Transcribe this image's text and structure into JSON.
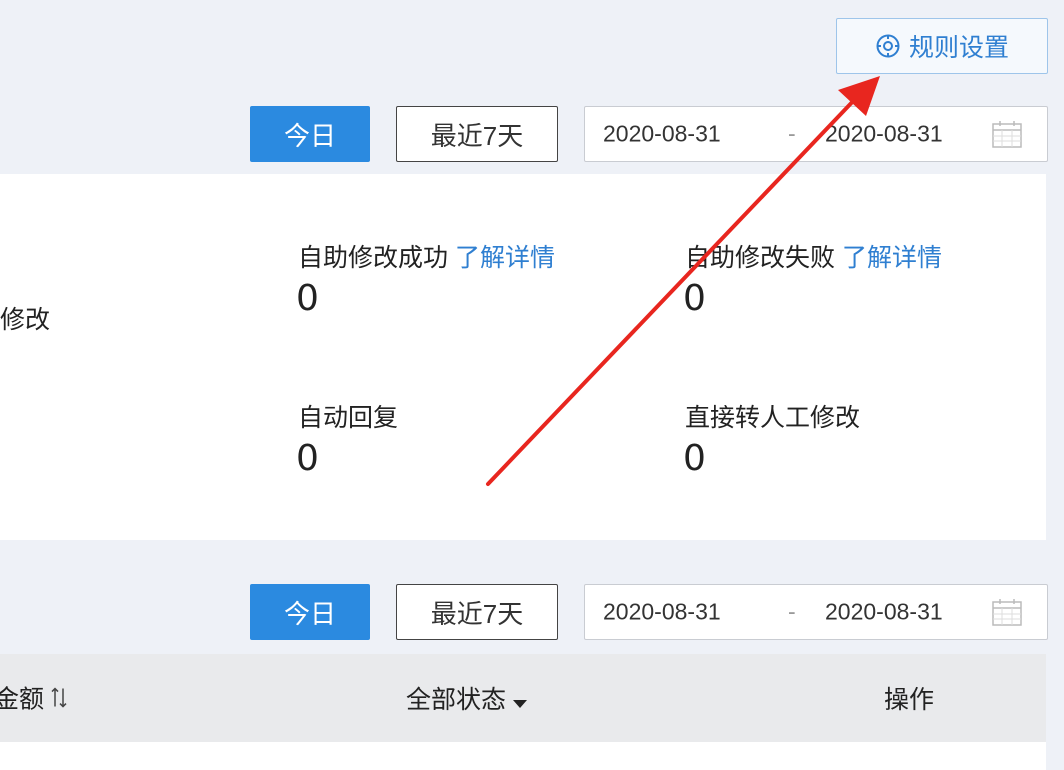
{
  "header": {
    "rule_settings_label": "规则设置",
    "rule_settings_icon": "settings-cog-icon"
  },
  "filter_top": {
    "today_label": "今日",
    "last7_label": "最近7天",
    "date_start": "2020-08-31",
    "date_sep": "-",
    "date_end": "2020-08-31",
    "calendar_icon": "calendar-icon"
  },
  "stats": {
    "left_label": "修改",
    "items": [
      {
        "label": "自助修改成功",
        "link": "了解详情",
        "value": "0"
      },
      {
        "label": "自助修改失败",
        "link": "了解详情",
        "value": "0"
      },
      {
        "label": "自动回复",
        "link": "",
        "value": "0"
      },
      {
        "label": "直接转人工修改",
        "link": "",
        "value": "0"
      }
    ]
  },
  "filter_bottom": {
    "today_label": "今日",
    "last7_label": "最近7天",
    "date_start": "2020-08-31",
    "date_sep": "-",
    "date_end": "2020-08-31",
    "calendar_icon": "calendar-icon"
  },
  "table": {
    "columns": [
      "金额",
      "全部状态",
      "操作"
    ],
    "sort_icon": "sort-icon",
    "dropdown_icon": "caret-down-icon"
  },
  "colors": {
    "primary": "#2b8ae0",
    "link": "#2f7fd1",
    "annotation_arrow": "#e8261f",
    "background": "#eef1f7"
  }
}
